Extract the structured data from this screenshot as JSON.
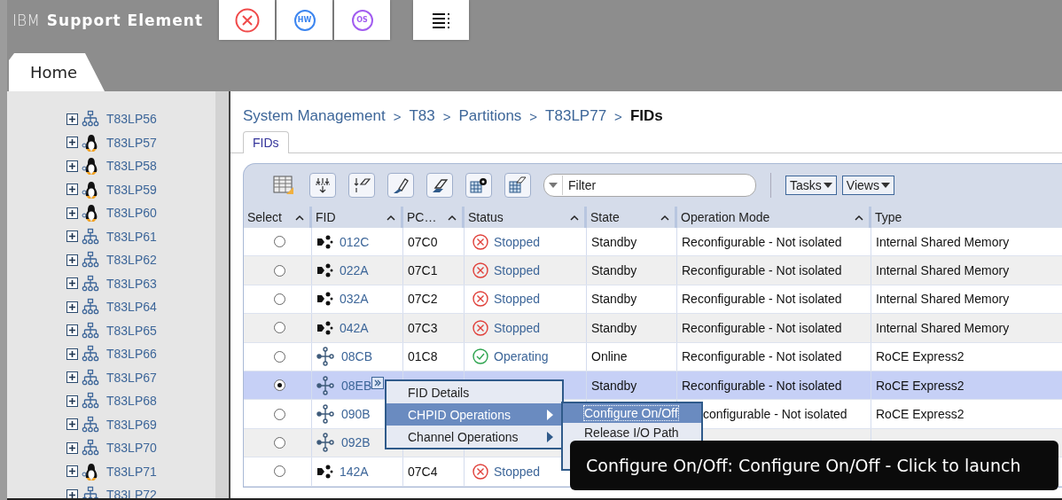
{
  "header": {
    "brand": "IBM",
    "product": "Support Element",
    "quick_buttons": [
      {
        "kind": "close",
        "color": "#f04a4a"
      },
      {
        "kind": "badge",
        "label": "HW",
        "color": "#3d86f0"
      },
      {
        "kind": "badge",
        "label": "OS",
        "color": "#a25df0"
      }
    ],
    "menu_button": {
      "kind": "menu"
    }
  },
  "tabs": [
    {
      "label": "Home",
      "selected": true
    }
  ],
  "tree": {
    "items": [
      {
        "label": "T83LP56",
        "kind": "network",
        "expanded": false
      },
      {
        "label": "T83LP57",
        "kind": "linux",
        "expanded": false
      },
      {
        "label": "T83LP58",
        "kind": "linux",
        "expanded": false
      },
      {
        "label": "T83LP59",
        "kind": "linux",
        "expanded": false
      },
      {
        "label": "T83LP60",
        "kind": "linux",
        "expanded": false
      },
      {
        "label": "T83LP61",
        "kind": "network",
        "expanded": false
      },
      {
        "label": "T83LP62",
        "kind": "network",
        "expanded": false
      },
      {
        "label": "T83LP63",
        "kind": "network",
        "expanded": false
      },
      {
        "label": "T83LP64",
        "kind": "network",
        "expanded": false
      },
      {
        "label": "T83LP65",
        "kind": "network",
        "expanded": false
      },
      {
        "label": "T83LP66",
        "kind": "network",
        "expanded": false
      },
      {
        "label": "T83LP67",
        "kind": "network",
        "expanded": false
      },
      {
        "label": "T83LP68",
        "kind": "network",
        "expanded": false
      },
      {
        "label": "T83LP69",
        "kind": "network",
        "expanded": false
      },
      {
        "label": "T83LP70",
        "kind": "network",
        "expanded": false
      },
      {
        "label": "T83LP71",
        "kind": "linux",
        "expanded": false
      },
      {
        "label": "T83LP72",
        "kind": "network",
        "expanded": false
      }
    ]
  },
  "breadcrumb": [
    {
      "text": "System Management",
      "kind": "link"
    },
    {
      "text": ">",
      "kind": "separator"
    },
    {
      "text": "T83",
      "kind": "link"
    },
    {
      "text": ">",
      "kind": "separator"
    },
    {
      "text": "Partitions",
      "kind": "link"
    },
    {
      "text": ">",
      "kind": "separator"
    },
    {
      "text": "T83LP77",
      "kind": "link"
    },
    {
      "text": ">",
      "kind": "separator"
    },
    {
      "text": "FIDs",
      "kind": "current"
    }
  ],
  "page_tabs": [
    {
      "label": "FIDs",
      "selected": true
    }
  ],
  "toolbar": {
    "buttons": [
      {
        "kind": "table-settings"
      },
      {
        "kind": "arrows-down"
      },
      {
        "kind": "eraser-down"
      },
      {
        "kind": "pen"
      },
      {
        "kind": "eraser"
      },
      {
        "kind": "table-gear"
      },
      {
        "kind": "table-eraser"
      }
    ],
    "filter": {
      "placeholder": "Filter"
    },
    "menus": [
      "Tasks",
      "Views"
    ]
  },
  "table": {
    "columns": [
      {
        "label": "Select",
        "sortable": true
      },
      {
        "label": "FID",
        "sortable": true
      },
      {
        "label": "PC…",
        "sortable": true
      },
      {
        "label": "Status",
        "sortable": true
      },
      {
        "label": "State",
        "sortable": true
      },
      {
        "label": "Operation Mode",
        "sortable": true
      },
      {
        "label": "Type",
        "sortable": false
      }
    ],
    "rows": [
      {
        "selected": false,
        "launcher": false,
        "fid": {
          "text": "012C",
          "kind": "ism"
        },
        "pchid": "07C0",
        "status": {
          "kind": "stopped",
          "text": "Stopped"
        },
        "state": "Standby",
        "mode": "Reconfigurable - Not isolated",
        "type": "Internal Shared Memory"
      },
      {
        "selected": false,
        "launcher": false,
        "fid": {
          "text": "022A",
          "kind": "ism"
        },
        "pchid": "07C1",
        "status": {
          "kind": "stopped",
          "text": "Stopped"
        },
        "state": "Standby",
        "mode": "Reconfigurable - Not isolated",
        "type": "Internal Shared Memory"
      },
      {
        "selected": false,
        "launcher": false,
        "fid": {
          "text": "032A",
          "kind": "ism"
        },
        "pchid": "07C2",
        "status": {
          "kind": "stopped",
          "text": "Stopped"
        },
        "state": "Standby",
        "mode": "Reconfigurable - Not isolated",
        "type": "Internal Shared Memory"
      },
      {
        "selected": false,
        "launcher": false,
        "fid": {
          "text": "042A",
          "kind": "ism"
        },
        "pchid": "07C3",
        "status": {
          "kind": "stopped",
          "text": "Stopped"
        },
        "state": "Standby",
        "mode": "Reconfigurable - Not isolated",
        "type": "Internal Shared Memory"
      },
      {
        "selected": false,
        "launcher": false,
        "fid": {
          "text": "08CB",
          "kind": "roce"
        },
        "pchid": "01C8",
        "status": {
          "kind": "operating",
          "text": "Operating"
        },
        "state": "Online",
        "mode": "Reconfigurable - Not isolated",
        "type": "RoCE Express2"
      },
      {
        "selected": true,
        "launcher": true,
        "fid": {
          "text": "08EB",
          "kind": "roce"
        },
        "state": "Standby",
        "mode": "Reconfigurable - Not isolated",
        "type": "RoCE Express2"
      },
      {
        "selected": false,
        "launcher": false,
        "fid": {
          "text": "090B",
          "kind": "roce"
        },
        "mode": "configurable - Not isolated",
        "type": "RoCE Express2"
      },
      {
        "selected": false,
        "launcher": false,
        "fid": {
          "text": "092B",
          "kind": "roce"
        }
      },
      {
        "selected": false,
        "launcher": false,
        "fid": {
          "text": "142A",
          "kind": "ism"
        },
        "pchid": "07C4",
        "status": {
          "kind": "stopped",
          "text": "Stopped"
        }
      }
    ]
  },
  "context_menu": {
    "items": [
      {
        "label": "FID Details",
        "submenu": false,
        "selected": false
      },
      {
        "label": "CHPID Operations",
        "submenu": true,
        "selected": true
      },
      {
        "label": "Channel Operations",
        "submenu": true,
        "selected": false
      }
    ]
  },
  "submenu": {
    "items": [
      {
        "label": "Configure On/Off",
        "selected": true
      },
      {
        "label": "Release I/O Path",
        "selected": false
      }
    ]
  },
  "tooltip": {
    "text": "Configure On/Off: Configure On/Off - Click to launch"
  }
}
